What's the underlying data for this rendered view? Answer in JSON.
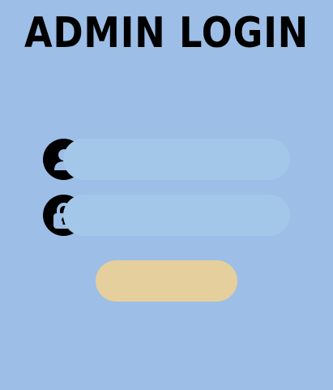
{
  "title": "ADMIN LOGIN",
  "form": {
    "username": {
      "icon": "user-icon",
      "value": "",
      "placeholder": ""
    },
    "password": {
      "icon": "lock-icon",
      "value": "",
      "placeholder": ""
    },
    "submit_label": ""
  },
  "colors": {
    "background": "#9dbee6",
    "field": "#a3c7e8",
    "icon_circle": "#000000",
    "icon_glyph": "#9dbee6",
    "button": "#e5cf9c"
  }
}
